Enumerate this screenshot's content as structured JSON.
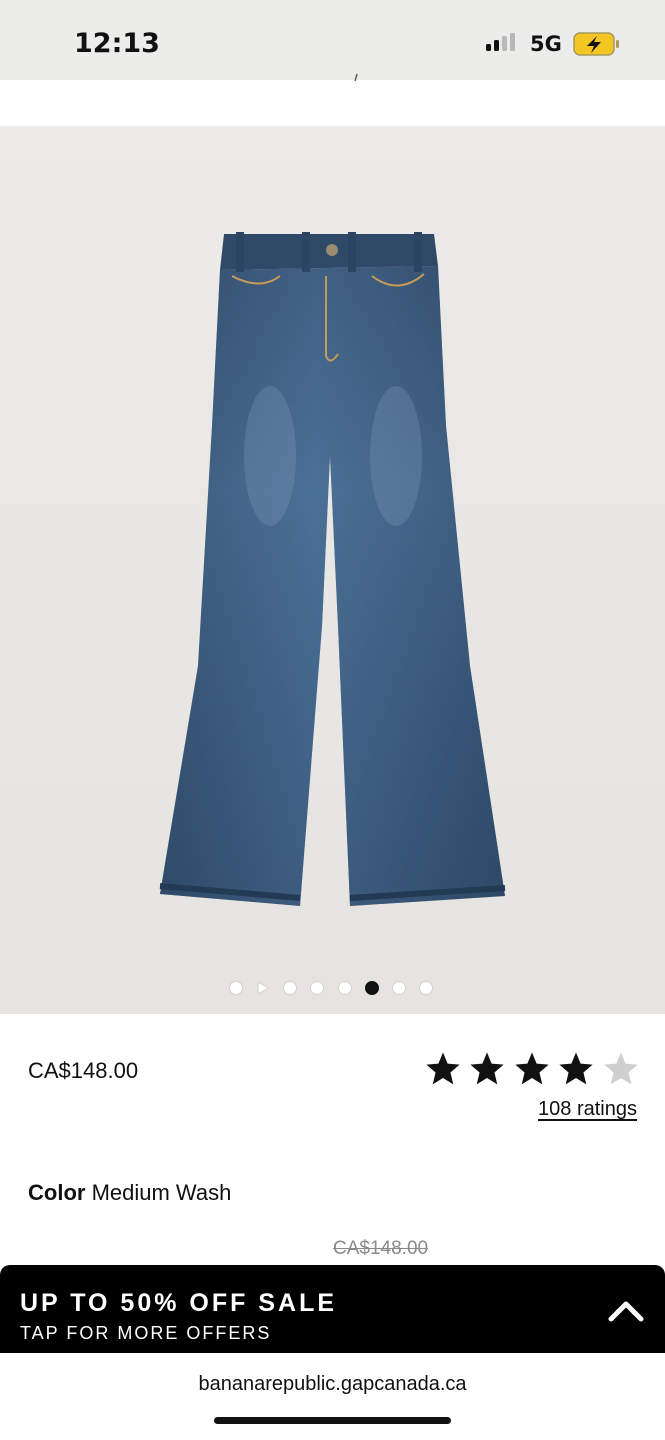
{
  "status_bar": {
    "time": "12:13",
    "network": "5G",
    "signal_icon": "signal-bars-icon",
    "battery_icon": "battery-charging-icon"
  },
  "product": {
    "image_alt_icon": "flare-jeans-image",
    "price": "CA$148.00",
    "rating": {
      "value": 4,
      "max": 5
    },
    "ratings_link": "108 ratings",
    "color_label": "Color",
    "color_value": "Medium Wash",
    "original_price": "CA$148.00"
  },
  "carousel": {
    "total_slides": 8,
    "active_index": 5,
    "video_slide_index": 1
  },
  "promo": {
    "title": "UP TO 50% OFF SALE",
    "subtitle": "TAP FOR MORE OFFERS",
    "expand_icon": "chevron-up-icon"
  },
  "browser": {
    "url": "bananarepublic.gapcanada.ca"
  },
  "colors": {
    "star_filled": "#111111",
    "star_empty": "#cfcfcf",
    "banner_bg": "#000000",
    "denim": "#3d5a7a"
  }
}
